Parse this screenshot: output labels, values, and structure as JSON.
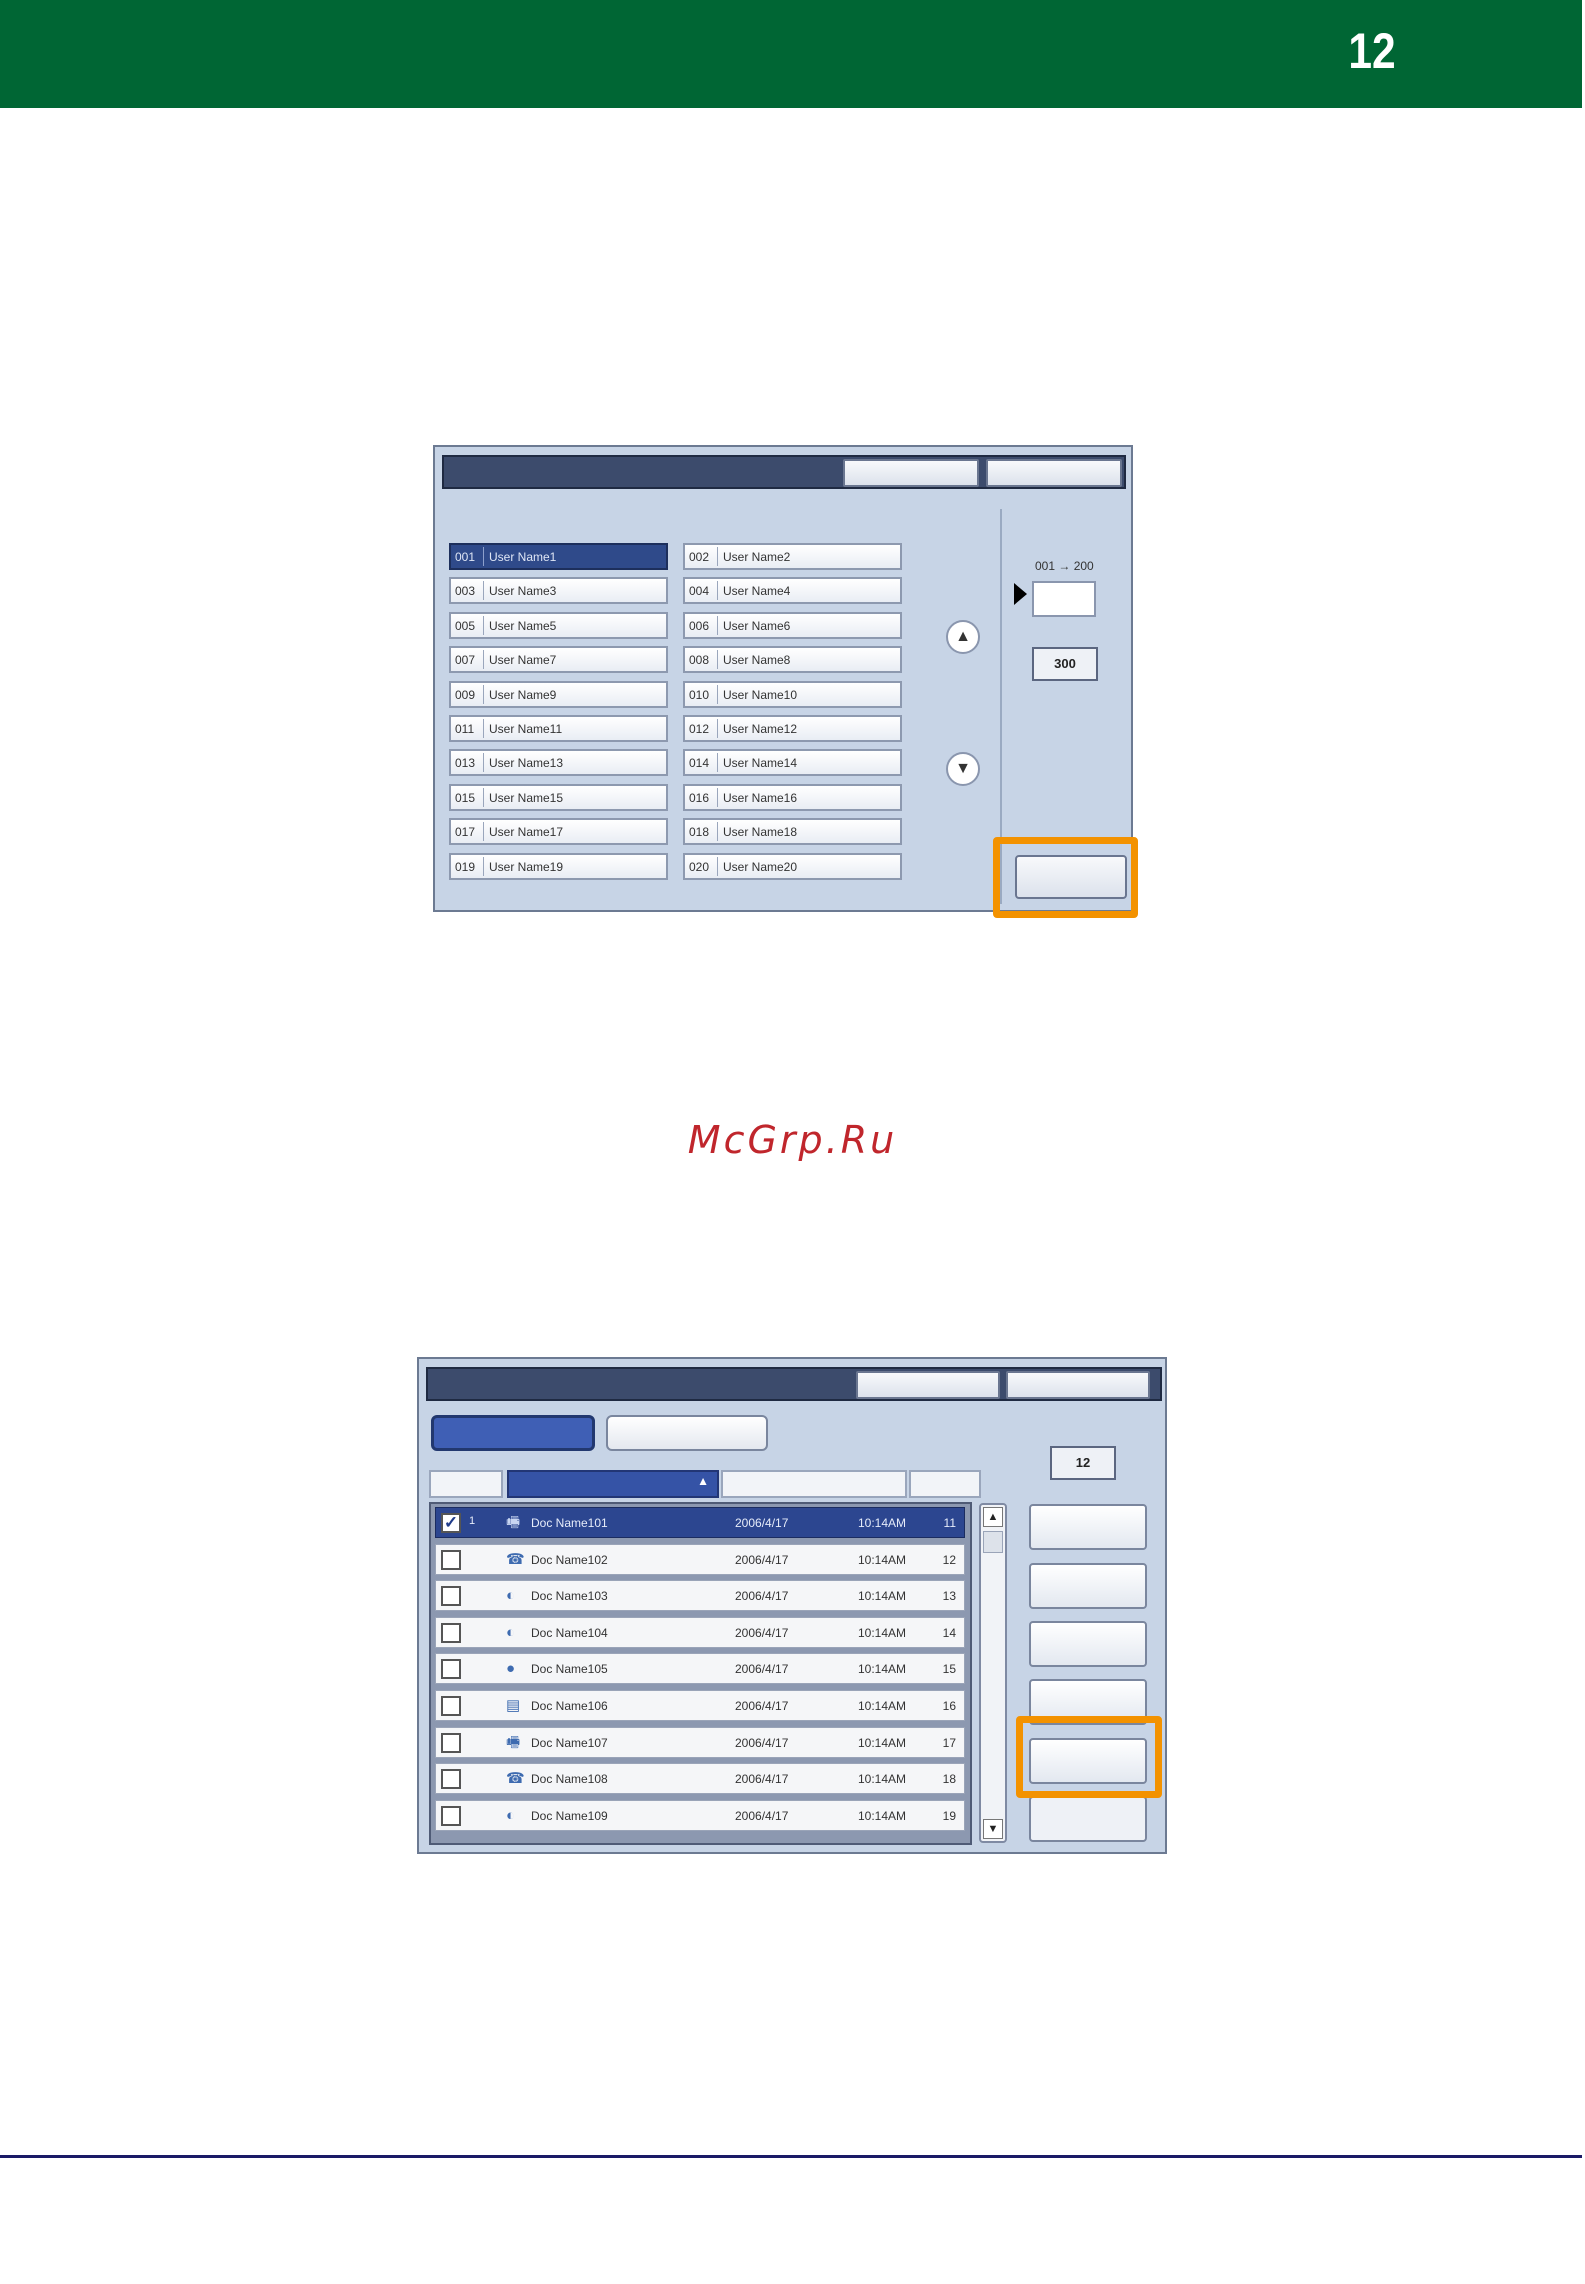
{
  "page": {
    "number": "12",
    "watermark": "McGrp.Ru"
  },
  "colors": {
    "header_green": "#006634",
    "highlight_orange": "#f39200",
    "selection_blue": "#2f4a8a"
  },
  "screen1": {
    "users": [
      {
        "num": "001",
        "name": "User Name1",
        "selected": true
      },
      {
        "num": "002",
        "name": "User Name2"
      },
      {
        "num": "003",
        "name": "User Name3"
      },
      {
        "num": "004",
        "name": "User Name4"
      },
      {
        "num": "005",
        "name": "User Name5"
      },
      {
        "num": "006",
        "name": "User Name6"
      },
      {
        "num": "007",
        "name": "User Name7"
      },
      {
        "num": "008",
        "name": "User Name8"
      },
      {
        "num": "009",
        "name": "User Name9"
      },
      {
        "num": "010",
        "name": "User Name10"
      },
      {
        "num": "011",
        "name": "User Name11"
      },
      {
        "num": "012",
        "name": "User Name12"
      },
      {
        "num": "013",
        "name": "User Name13"
      },
      {
        "num": "014",
        "name": "User Name14"
      },
      {
        "num": "015",
        "name": "User Name15"
      },
      {
        "num": "016",
        "name": "User Name16"
      },
      {
        "num": "017",
        "name": "User Name17"
      },
      {
        "num": "018",
        "name": "User Name18"
      },
      {
        "num": "019",
        "name": "User Name19"
      },
      {
        "num": "020",
        "name": "User Name20"
      }
    ],
    "range_label": "001 → 200",
    "total": "300",
    "icons": {
      "scroll_up": "scroll-up-icon",
      "scroll_down": "scroll-down-icon",
      "pointer": "pointer-arrow-icon"
    }
  },
  "screen2": {
    "count": "12",
    "documents": [
      {
        "index": "1",
        "name": "Doc Name101",
        "date": "2006/4/17",
        "time": "10:14AM",
        "count": "11",
        "checked": true,
        "selected": true,
        "icon": "fax-icon"
      },
      {
        "index": "",
        "name": "Doc Name102",
        "date": "2006/4/17",
        "time": "10:14AM",
        "count": "12",
        "checked": false,
        "icon": "phone-icon"
      },
      {
        "index": "",
        "name": "Doc Name103",
        "date": "2006/4/17",
        "time": "10:14AM",
        "count": "13",
        "checked": false,
        "icon": "internet-fax-icon"
      },
      {
        "index": "",
        "name": "Doc Name104",
        "date": "2006/4/17",
        "time": "10:14AM",
        "count": "14",
        "checked": false,
        "icon": "internet-fax-icon"
      },
      {
        "index": "",
        "name": "Doc Name105",
        "date": "2006/4/17",
        "time": "10:14AM",
        "count": "15",
        "checked": false,
        "icon": "globe-icon"
      },
      {
        "index": "",
        "name": "Doc Name106",
        "date": "2006/4/17",
        "time": "10:14AM",
        "count": "16",
        "checked": false,
        "icon": "scanner-icon"
      },
      {
        "index": "",
        "name": "Doc Name107",
        "date": "2006/4/17",
        "time": "10:14AM",
        "count": "17",
        "checked": false,
        "icon": "fax-icon"
      },
      {
        "index": "",
        "name": "Doc Name108",
        "date": "2006/4/17",
        "time": "10:14AM",
        "count": "18",
        "checked": false,
        "icon": "phone-icon"
      },
      {
        "index": "",
        "name": "Doc Name109",
        "date": "2006/4/17",
        "time": "10:14AM",
        "count": "19",
        "checked": false,
        "icon": "internet-fax-icon"
      }
    ],
    "icons": {
      "sort_ascending": "sort-ascending-icon",
      "checkmark": "checkmark-icon",
      "scroll_up": "scroll-up-icon",
      "scroll_down": "scroll-down-icon"
    }
  }
}
